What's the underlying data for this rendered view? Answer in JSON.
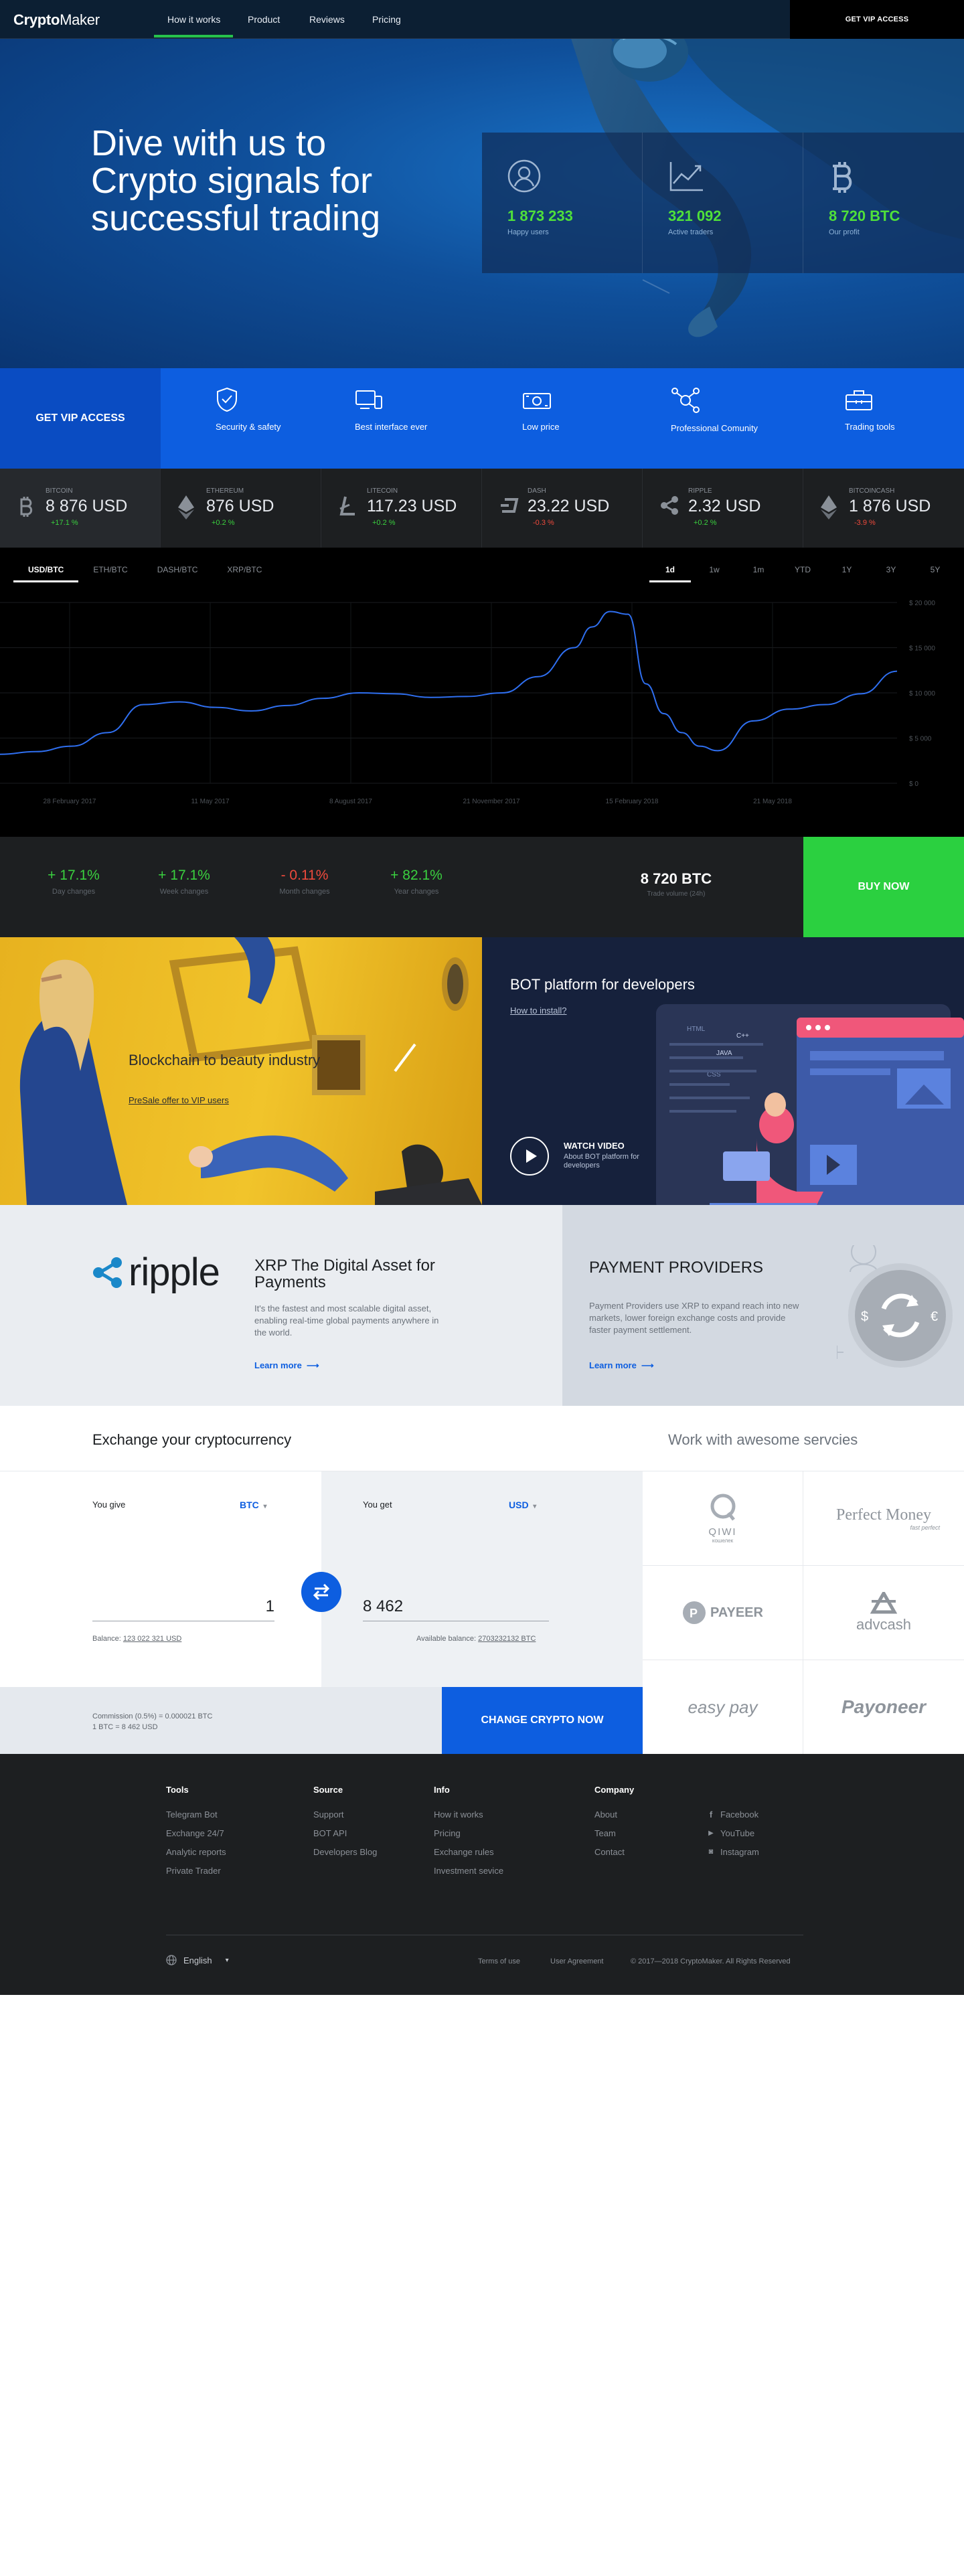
{
  "nav": {
    "logo_bold": "Crypto",
    "logo_light": "Maker",
    "links": [
      "How it works",
      "Product",
      "Reviews",
      "Pricing"
    ],
    "vip_button": "GET VIP ACCESS"
  },
  "hero": {
    "title": "Dive with us to Crypto signals for successful trading",
    "stats": [
      {
        "icon": "user-icon",
        "value": "1 873 233",
        "label": "Happy users"
      },
      {
        "icon": "growth-chart-icon",
        "value": "321 092",
        "label": "Active traders"
      },
      {
        "icon": "bitcoin-icon",
        "value": "8 720 BTC",
        "label": "Our profit"
      }
    ]
  },
  "features": {
    "vip_label": "GET VIP ACCESS",
    "items": [
      {
        "icon": "shield-check-icon",
        "label": "Security & safety"
      },
      {
        "icon": "devices-icon",
        "label": "Best interface ever"
      },
      {
        "icon": "banknote-icon",
        "label": "Low price"
      },
      {
        "icon": "network-user-icon",
        "label": "Professional Comunity"
      },
      {
        "icon": "toolbox-icon",
        "label": "Trading tools"
      }
    ]
  },
  "tickers": [
    {
      "icon": "bitcoin-coin-icon",
      "name": "BITCOIN",
      "price": "8 876 USD",
      "change": "+17.1 %",
      "dir": "up"
    },
    {
      "icon": "ethereum-coin-icon",
      "name": "ETHEREUM",
      "price": "876 USD",
      "change": "+0.2 %",
      "dir": "up"
    },
    {
      "icon": "litecoin-coin-icon",
      "name": "LITECOIN",
      "price": "117.23 USD",
      "change": "+0.2 %",
      "dir": "up"
    },
    {
      "icon": "dash-coin-icon",
      "name": "DASH",
      "price": "23.22 USD",
      "change": "-0.3 %",
      "dir": "dn"
    },
    {
      "icon": "ripple-coin-icon",
      "name": "RIPPLE",
      "price": "2.32 USD",
      "change": "+0.2 %",
      "dir": "up"
    },
    {
      "icon": "bitcoincash-coin-icon",
      "name": "BITCOINCASH",
      "price": "1 876 USD",
      "change": "-3.9 %",
      "dir": "dn"
    }
  ],
  "chart_controls": {
    "pairs": [
      "USD/BTC",
      "ETH/BTC",
      "DASH/BTC",
      "XRP/BTC"
    ],
    "active_pair": 0,
    "ranges": [
      "1d",
      "1w",
      "1m",
      "YTD",
      "1Y",
      "3Y",
      "5Y"
    ],
    "active_range": 0
  },
  "chart_data": {
    "type": "line",
    "title": "",
    "xlabel": "",
    "ylabel": "",
    "x_ticks": [
      "28 February 2017",
      "11 May 2017",
      "8 August 2017",
      "21 November 2017",
      "15 February 2018",
      "21 May 2018"
    ],
    "y_ticks": [
      "$ 20 000",
      "$ 15 000",
      "$ 10 000",
      "$ 5 000",
      "$ 0"
    ],
    "ylim": [
      0,
      20000
    ],
    "grid": true,
    "x": [
      0,
      4,
      8,
      12,
      16,
      20,
      24,
      28,
      32,
      36,
      40,
      44,
      48,
      52,
      56,
      60,
      64,
      66,
      68,
      70,
      72,
      74,
      76,
      78,
      80,
      84,
      88,
      92,
      96,
      100
    ],
    "series": [
      {
        "values": [
          3200,
          3500,
          4100,
          5600,
          8700,
          9000,
          8400,
          8000,
          8600,
          9400,
          10000,
          9900,
          9500,
          9600,
          10000,
          11800,
          15000,
          17300,
          19000,
          18700,
          11000,
          7700,
          5600,
          4100,
          3600,
          6900,
          8200,
          8700,
          9900,
          12400
        ]
      }
    ]
  },
  "summary": {
    "changes": [
      {
        "value": "+ 17.1%",
        "label": "Day changes",
        "dir": "up"
      },
      {
        "value": "+ 17.1%",
        "label": "Week changes",
        "dir": "up"
      },
      {
        "value": "- 0.11%",
        "label": "Month changes",
        "dir": "dn"
      },
      {
        "value": "+ 82.1%",
        "label": "Year changes",
        "dir": "up"
      }
    ],
    "volume_value": "8 720 BTC",
    "volume_label": "Trade volume (24h)",
    "buy_button": "BUY NOW"
  },
  "promo": {
    "blockchain_title": "Blockchain to beauty industry",
    "blockchain_link": "PreSale offer to VIP users",
    "bot_title": "BOT platform for developers",
    "bot_link": "How to install?",
    "watch_title": "WATCH VIDEO",
    "watch_sub": "About BOT platform for developers",
    "code_tags": [
      "HTML",
      "C++",
      "JAVA",
      "CSS"
    ]
  },
  "ripple": {
    "logo_text": "ripple",
    "title": "XRP The Digital Asset for Payments",
    "text": "It's the fastest and most scalable digital asset, enabling real-time global payments anywhere in the world.",
    "learn": "Learn more"
  },
  "providers": {
    "title": "PAYMENT PROVIDERS",
    "text": "Payment Providers use XRP to expand reach into new markets, lower foreign exchange costs and provide faster payment settlement.",
    "learn": "Learn more"
  },
  "exchange": {
    "title": "Exchange your cryptocurrency",
    "work_title": "Work with awesome servcies",
    "give_label": "You give",
    "give_currency": "BTC",
    "give_amount": "1",
    "balance_label": "Balance:",
    "balance_value": "123 022 321 USD",
    "get_label": "You get",
    "get_currency": "USD",
    "get_amount": "8 462",
    "available_label": "Available balance:",
    "available_value": "2703232132 BTC",
    "commission": "Commission (0.5%) = 0.000021 BTC",
    "rate": "1 BTC = 8 462 USD",
    "change_button": "CHANGE CRYPTO NOW",
    "partners": [
      "QIWI",
      "Perfect Money",
      "PAYEER",
      "advcash",
      "easy pay",
      "Payoneer"
    ],
    "partner_subs": [
      "кошелек",
      "fast perfect"
    ]
  },
  "footer": {
    "columns": [
      {
        "title": "Tools",
        "items": [
          "Telegram Bot",
          "Exchange 24/7",
          "Analytic reports",
          "Private Trader"
        ]
      },
      {
        "title": "Source",
        "items": [
          "Support",
          "BOT API",
          "Developers Blog"
        ]
      },
      {
        "title": "Info",
        "items": [
          "How it works",
          "Pricing",
          "Exchange rules",
          "Investment sevice"
        ]
      },
      {
        "title": "Company",
        "items": [
          "About",
          "Team",
          "Contact"
        ]
      }
    ],
    "social": [
      {
        "icon": "facebook-icon",
        "label": "Facebook"
      },
      {
        "icon": "youtube-icon",
        "label": "YouTube"
      },
      {
        "icon": "instagram-icon",
        "label": "Instagram"
      }
    ],
    "language": "English",
    "terms": "Terms of use",
    "agreement": "User Agreement",
    "copyright": "© 2017—2018 CryptoMaker. All Rights Reserved"
  },
  "colors": {
    "accent_blue": "#0d5ee0",
    "accent_green": "#2bd040",
    "hero_blue": "#0f4f9a",
    "dark": "#1d1f21",
    "positive": "#3ad13f",
    "negative": "#f04a3c"
  }
}
